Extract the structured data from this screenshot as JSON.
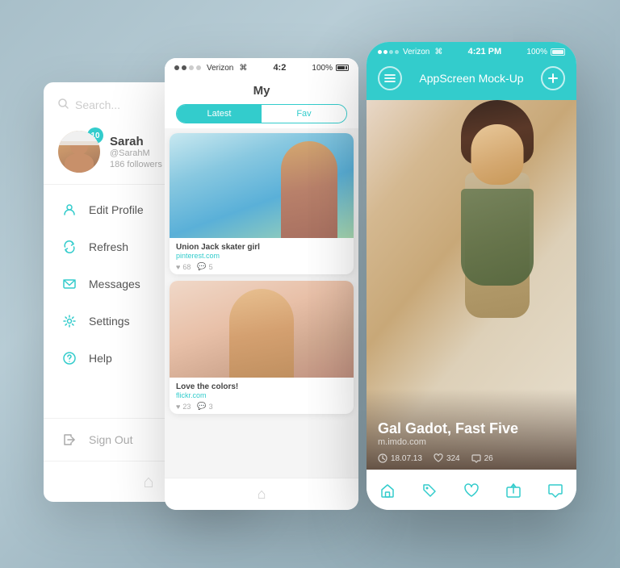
{
  "app": {
    "title": "AppScreen Mock-Up"
  },
  "menu": {
    "search_placeholder": "Search...",
    "profile": {
      "name": "Sarah",
      "handle": "@SarahM",
      "followers": "186 followers",
      "badge": "10"
    },
    "items": [
      {
        "id": "edit-profile",
        "label": "Edit Profile",
        "icon": "person"
      },
      {
        "id": "refresh",
        "label": "Refresh",
        "icon": "refresh"
      },
      {
        "id": "messages",
        "label": "Messages",
        "icon": "envelope"
      },
      {
        "id": "settings",
        "label": "Settings",
        "icon": "gear"
      },
      {
        "id": "help",
        "label": "Help",
        "icon": "question"
      }
    ],
    "signout": "Sign Out"
  },
  "feed": {
    "status": {
      "carrier": "Verizon",
      "time": "4:2",
      "battery": "100%"
    },
    "title": "My",
    "tabs": [
      {
        "label": "Latest",
        "active": true
      },
      {
        "label": "Fav",
        "active": false
      }
    ],
    "cards": [
      {
        "title": "Union Jack skater girl",
        "source": "pinterest.com",
        "likes": "68",
        "comments": "5"
      },
      {
        "title": "Love the colors!",
        "source": "flickr.com",
        "likes": "23",
        "comments": "3"
      }
    ]
  },
  "detail": {
    "status": {
      "carrier": "Verizon",
      "time": "4:21 PM",
      "battery": "100%"
    },
    "title_normal": "AppScreen",
    "title_light": " Mock-Up",
    "hero": {
      "name": "Gal Gadot, Fast Five",
      "source": "m.imdo.com",
      "date": "18.07.13",
      "likes": "324",
      "comments": "26"
    },
    "nav": [
      "home",
      "tag",
      "heart",
      "share",
      "chat"
    ]
  },
  "colors": {
    "teal": "#33cccc",
    "text_dark": "#444444",
    "text_mid": "#888888",
    "text_light": "#aaaaaa"
  }
}
